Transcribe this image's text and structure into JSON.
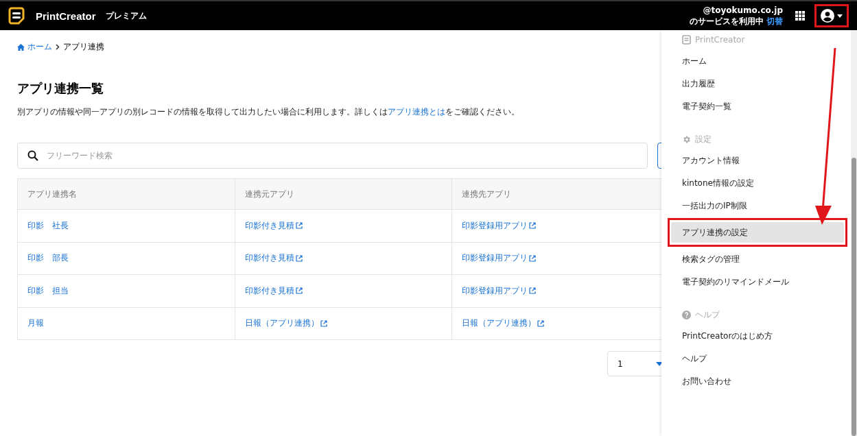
{
  "header": {
    "brand": "PrintCreator",
    "plan": "プレミアム",
    "account": "@toyokumo.co.jp",
    "service_note": "のサービスを利用中",
    "switch_link": "切替"
  },
  "breadcrumb": [
    {
      "label": "ホーム",
      "kind": "home"
    },
    {
      "label": "アプリ連携",
      "kind": "current"
    }
  ],
  "page": {
    "title": "アプリ連携一覧",
    "description_before": "別アプリの情報や同一アプリの別レコードの情報を取得して出力したい場合に利用します。詳しくは",
    "description_link": "アプリ連携とは",
    "description_after": "をご確認ください。"
  },
  "search": {
    "placeholder": "フリーワード検索"
  },
  "table": {
    "columns": [
      "アプリ連携名",
      "連携元アプリ",
      "連携先アプリ"
    ],
    "rows": [
      [
        "印影　社長",
        "印影付き見積",
        "印影登録用アプリ"
      ],
      [
        "印影　部長",
        "印影付き見積",
        "印影登録用アプリ"
      ],
      [
        "印影　担当",
        "印影付き見積",
        "印影登録用アプリ"
      ],
      [
        "月報",
        "日報（アプリ連携）",
        "日報（アプリ連携）"
      ]
    ]
  },
  "pagination": {
    "value": "1"
  },
  "menu": {
    "sections": [
      {
        "title": "PrintCreator",
        "kind": "app",
        "items": [
          {
            "label": "ホーム",
            "selected": false
          },
          {
            "label": "出力履歴",
            "selected": false
          },
          {
            "label": "電子契約一覧",
            "selected": false
          }
        ]
      },
      {
        "title": "設定",
        "kind": "settings",
        "items": [
          {
            "label": "アカウント情報",
            "selected": false
          },
          {
            "label": "kintone情報の設定",
            "selected": false
          },
          {
            "label": "一括出力のIP制限",
            "selected": false
          },
          {
            "label": "アプリ連携の設定",
            "selected": true
          },
          {
            "label": "検索タグの管理",
            "selected": false
          },
          {
            "label": "電子契約のリマインドメール",
            "selected": false
          }
        ]
      },
      {
        "title": "ヘルプ",
        "kind": "help",
        "items": [
          {
            "label": "PrintCreatorのはじめ方",
            "selected": false
          },
          {
            "label": "ヘルプ",
            "selected": false
          },
          {
            "label": "お問い合わせ",
            "selected": false
          }
        ]
      }
    ]
  }
}
